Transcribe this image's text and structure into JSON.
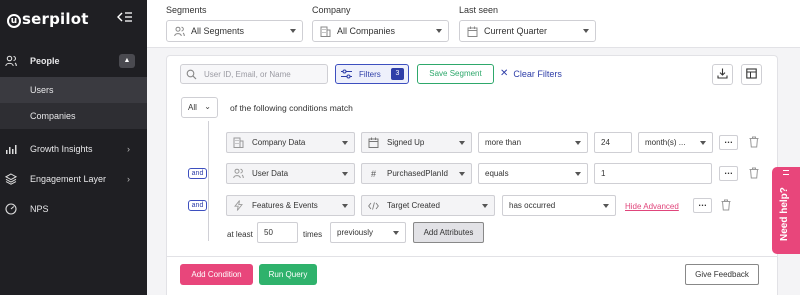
{
  "sidebar": {
    "logo_text": "serpilot",
    "logo_letter": "u",
    "items": [
      {
        "label": "People",
        "icon": "people-icon"
      },
      {
        "label": "Users"
      },
      {
        "label": "Companies"
      },
      {
        "label": "Growth Insights",
        "icon": "bar-chart-icon"
      },
      {
        "label": "Engagement Layer",
        "icon": "layers-icon"
      },
      {
        "label": "NPS",
        "icon": "gauge-icon"
      }
    ]
  },
  "topbar": {
    "segments": {
      "label": "Segments",
      "value": "All Segments",
      "icon": "users-icon"
    },
    "company": {
      "label": "Company",
      "value": "All Companies",
      "icon": "building-icon"
    },
    "last_seen": {
      "label": "Last seen",
      "value": "Current Quarter",
      "icon": "calendar-icon"
    }
  },
  "toolbar": {
    "search_placeholder": "User ID, Email, or Name",
    "filters_label": "Filters",
    "filters_count": "3",
    "save_segment_label": "Save Segment",
    "clear_filters_label": "Clear Filters"
  },
  "match": {
    "quantifier": "All",
    "text": "of the following conditions match"
  },
  "conditions": [
    {
      "source": "Company Data",
      "property": "Signed Up",
      "operator": "more than",
      "value": "24",
      "unit": "month(s) ..."
    },
    {
      "connector": "and",
      "source": "User Data",
      "property": "PurchasedPlanId",
      "operator": "equals",
      "value": "1"
    },
    {
      "connector": "and",
      "source": "Features & Events",
      "property": "Target Created",
      "operator": "has occurred",
      "advanced_link": "Hide Advanced",
      "at_least_label": "at least",
      "count": "50",
      "times_label": "times",
      "period": "previously",
      "add_attributes_label": "Add Attributes"
    }
  ],
  "footer": {
    "add_condition_label": "Add Condition",
    "run_query_label": "Run Query",
    "give_feedback_label": "Give Feedback"
  },
  "help": {
    "label": "Need help?"
  },
  "colors": {
    "sidebar_bg": "#1f1f23",
    "primary_blue": "#2e3ea8",
    "accent_pink": "#e8467b",
    "accent_green": "#2fb26c"
  }
}
